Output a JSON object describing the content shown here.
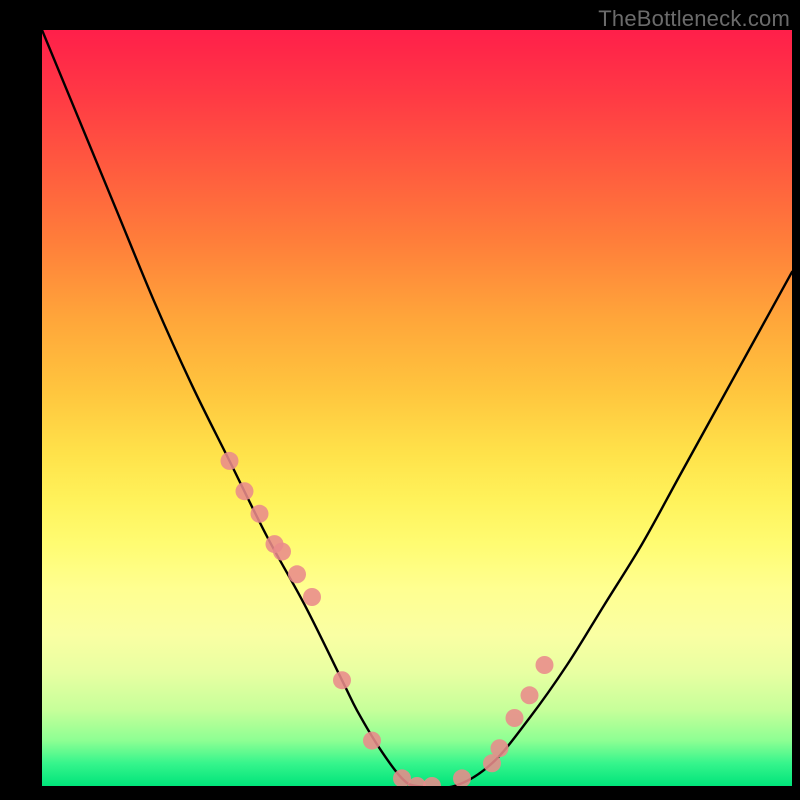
{
  "watermark": "TheBottleneck.com",
  "chart_data": {
    "type": "line",
    "title": "",
    "xlabel": "",
    "ylabel": "",
    "xlim": [
      0,
      100
    ],
    "ylim": [
      0,
      100
    ],
    "series": [
      {
        "name": "bottleneck-curve",
        "x": [
          0,
          5,
          10,
          15,
          20,
          25,
          30,
          35,
          40,
          42,
          45,
          48,
          50,
          55,
          60,
          65,
          70,
          75,
          80,
          85,
          90,
          95,
          100
        ],
        "y": [
          100,
          88,
          76,
          64,
          53,
          43,
          33,
          24,
          14,
          10,
          5,
          1,
          0,
          0,
          3,
          9,
          16,
          24,
          32,
          41,
          50,
          59,
          68
        ]
      }
    ],
    "markers": {
      "name": "data-points",
      "x": [
        25,
        27,
        29,
        31,
        32,
        34,
        36,
        40,
        44,
        48,
        50,
        52,
        56,
        60,
        61,
        63,
        65,
        67
      ],
      "y": [
        43,
        39,
        36,
        32,
        31,
        28,
        25,
        14,
        6,
        1,
        0,
        0,
        1,
        3,
        5,
        9,
        12,
        16
      ]
    },
    "gradient_stops": [
      {
        "pos": 0.0,
        "color": "#ff1f4a"
      },
      {
        "pos": 0.5,
        "color": "#ffe24a"
      },
      {
        "pos": 0.8,
        "color": "#faffa3"
      },
      {
        "pos": 1.0,
        "color": "#00e47a"
      }
    ]
  }
}
